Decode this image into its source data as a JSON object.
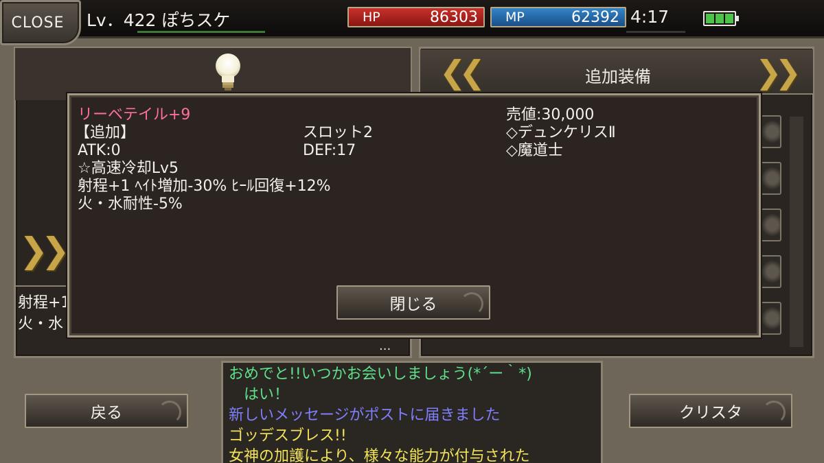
{
  "topbar": {
    "close_label": "CLOSE",
    "player": "Lv．422 ぽちスケ",
    "hp_label": "HP",
    "hp_value": "86303",
    "mp_label": "MP",
    "mp_value": "62392",
    "time": "4:17",
    "hp_color": "#c7302a",
    "mp_color": "#3484c8",
    "battery_icon": "battery-icon"
  },
  "right_panel": {
    "title": "追加装備"
  },
  "left_panel": {
    "stats": [
      "射程+1",
      "火・水"
    ],
    "more": "..."
  },
  "item_popup": {
    "name": "リーベテイル+9",
    "category": "【追加】",
    "atk": "ATK:0",
    "effect": "☆高速冷却Lv5",
    "bonus": "射程+1 ﾍｲﾄ増加-30% ﾋｰﾙ回復+12%",
    "resist": "火・水耐性-5%",
    "slots": "スロット2",
    "def": "DEF:17",
    "price": "売値:30,000",
    "job1": "◇デュンケリスⅡ",
    "job2": "◇魔道士",
    "close_button": "閉じる",
    "name_color": "#ff6f9d"
  },
  "buttons": {
    "back": "戻る",
    "crystal": "クリスタ"
  },
  "chat": [
    {
      "text": "おめでと!!いつかお会いしましょう(*´ー｀*)",
      "color": "#5fe08a"
    },
    {
      "text": "　はい！",
      "color": "#5fe08a"
    },
    {
      "text": "新しいメッセージがポストに届きました",
      "color": "#7f7fff"
    },
    {
      "text": "ゴッデスブレス!!",
      "color": "#f3e35a"
    },
    {
      "text": "女神の加護により、様々な能力が付与された",
      "color": "#f3e35a"
    }
  ]
}
